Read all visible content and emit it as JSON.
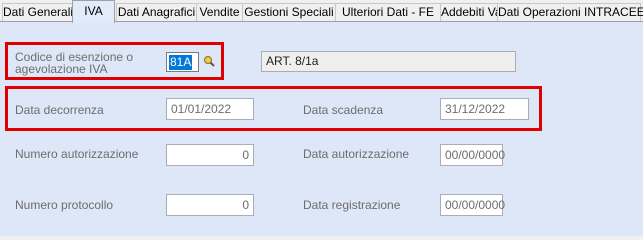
{
  "tabs": [
    {
      "label": "Dati Generali",
      "active": false
    },
    {
      "label": "IVA",
      "active": true
    },
    {
      "label": "Dati Anagrafici",
      "active": false
    },
    {
      "label": "Vendite",
      "active": false
    },
    {
      "label": "Gestioni Speciali",
      "active": false
    },
    {
      "label": "Ulteriori Dati - FE",
      "active": false
    },
    {
      "label": "Addebiti Vari",
      "active": false
    },
    {
      "label": "Dati Operazioni INTRACEE",
      "active": false
    }
  ],
  "exemption": {
    "label_line1": "Codice di esenzione o",
    "label_line2": "agevolazione IVA",
    "code": "81A",
    "description": "ART. 8/1a",
    "lookup_icon": "lookup-icon"
  },
  "dates": {
    "start_label": "Data decorrenza",
    "start_value": "01/01/2022",
    "end_label": "Data scadenza",
    "end_value": "31/12/2022"
  },
  "authorization": {
    "number_label": "Numero autorizzazione",
    "number_value": "0",
    "date_label": "Data autorizzazione",
    "date_value": "00/00/0000"
  },
  "protocol": {
    "number_label": "Numero protocollo",
    "number_value": "0",
    "date_label": "Data registrazione",
    "date_value": "00/00/0000"
  },
  "colors": {
    "highlight_box": "#e00000",
    "panel_bg": "#dde7f7",
    "selection": "#0078d7"
  }
}
